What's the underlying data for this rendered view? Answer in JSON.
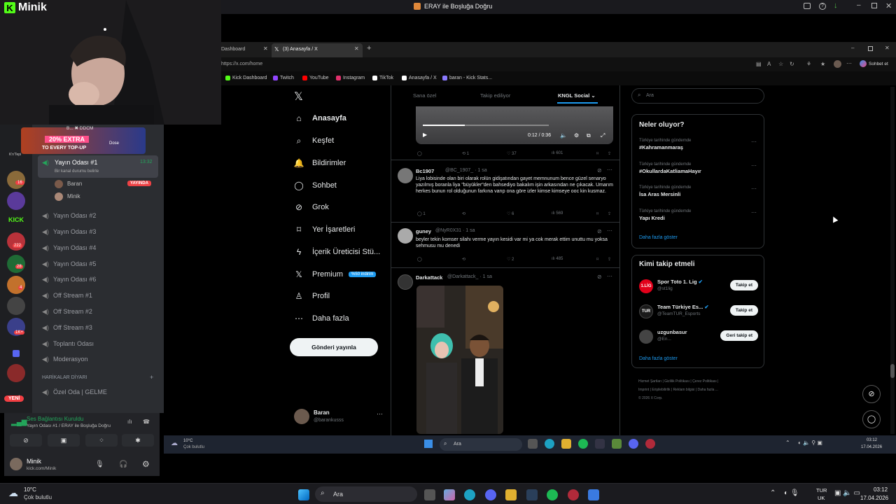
{
  "window_title": "ERAY ile Boşluğa Doğru",
  "stream_logo": "Minik",
  "discord": {
    "promo": {
      "line1": "20% EXTRA",
      "line2": "TO EVERY TOP-UP",
      "brand": "Dose"
    },
    "top_user": "B... ✖ DDCM",
    "active_channel": {
      "name": "Yayın Odası #1",
      "time": "13:32",
      "status": "Bir kanal durumu belirle"
    },
    "members": [
      {
        "name": "Baran",
        "badge": "YAYINDA"
      },
      {
        "name": "Minik",
        "badge": ""
      }
    ],
    "channels": [
      "Yayın Odası #2",
      "Yayın Odası #3",
      "Yayın Odası #4",
      "Yayın Odası #5",
      "Yayın Odası #6",
      "Off Stream #1",
      "Off Stream #2",
      "Off Stream #3",
      "Toplantı Odası",
      "Moderasyon"
    ],
    "category": "HARİKALAR DİYARI",
    "category_channel": "Özel Oda | GELME",
    "server_badges": [
      "16",
      "222",
      "28",
      "4",
      "1K+"
    ],
    "server_label": "K'n'Tepi",
    "new_label": "YENİ",
    "voice": {
      "status": "Ses Bağlantısı Kuruldu",
      "detail": "Yayın Odası #1 / ERAY ile Boşluğa Doğru"
    },
    "user": {
      "name": "Minik",
      "sub": "kick.com/Minik"
    }
  },
  "browser": {
    "tabs": [
      {
        "label": "Dashboard"
      },
      {
        "label": "(3) Anasayfa / X"
      }
    ],
    "url": "https://x.com/home",
    "chat_button": "Sohbet et",
    "bookmarks": [
      "Kick Dashboard",
      "Twitch",
      "YouTube",
      "Instagram",
      "TikTok",
      "Anasayfa / X",
      "baran - Kick Stats..."
    ]
  },
  "x": {
    "nav": [
      {
        "label": "Anasayfa",
        "icon": "home-icon"
      },
      {
        "label": "Keşfet",
        "icon": "search-icon"
      },
      {
        "label": "Bildirimler",
        "icon": "bell-icon"
      },
      {
        "label": "Sohbet",
        "icon": "chat-icon"
      },
      {
        "label": "Grok",
        "icon": "grok-icon"
      },
      {
        "label": "Yer İşaretleri",
        "icon": "bookmark-icon"
      },
      {
        "label": "İçerik Üreticisi Stü...",
        "icon": "lightning-icon"
      },
      {
        "label": "Premium",
        "icon": "x-logo-icon"
      },
      {
        "label": "Profil",
        "icon": "person-icon"
      },
      {
        "label": "Daha fazla",
        "icon": "more-icon"
      }
    ],
    "premium_badge": "%50 indirim",
    "post_button": "Gönderi yayınla",
    "profile": {
      "name": "Baran",
      "handle": "@barankusss"
    },
    "feed_tabs": [
      "Sana özel",
      "Takip ediliyor",
      "KNGL Social"
    ],
    "video": {
      "time": "0:12 / 0:36",
      "stats": {
        "reply": "",
        "retweet": "1",
        "like": "37",
        "views": "601"
      }
    },
    "tweets": [
      {
        "name": "Bc1907",
        "handle": "@BC_1907_ · 1 sa",
        "text": "Liya lobisinde olan biri olarak rolün gidişatından gayet memnunum bence güzel senaryo yazılmış boranla liya \"büyükler\"den bahsediyo bakalım işin arkasından ne çıkacak. Umarım herkes bunun rol olduğunun farkına varıp ona göre izler kimse kimseye ooc kin kusmaz.",
        "reply": "1",
        "retweet": "",
        "like": "6",
        "views": "569"
      },
      {
        "name": "guney",
        "handle": "@NyR0X31 · 1 sa",
        "text": "beyler tekin komser silahı verme yayın kesidi var mi ya cok merak ettim unuttu mu yoksa sehmusu mu denedi",
        "reply": "",
        "retweet": "",
        "like": "2",
        "views": "485"
      },
      {
        "name": "Darkattack",
        "handle": "@Darkattack_ · 1 sa",
        "text": "",
        "reply": "",
        "retweet": "",
        "like": "",
        "views": ""
      }
    ],
    "search_placeholder": "Ara",
    "trends_title": "Neler oluyor?",
    "trends": [
      {
        "context": "Türkiye tarihinde gündemde",
        "name": "#Kahramanmaraş"
      },
      {
        "context": "Türkiye tarihinde gündemde",
        "name": "#OkullardaKatliamaHayır"
      },
      {
        "context": "Türkiye tarihinde gündemde",
        "name": "İsa Aras Mersinli"
      },
      {
        "context": "Türkiye tarihinde gündemde",
        "name": "Yapı Kredi"
      }
    ],
    "show_more": "Daha fazla göster",
    "who_title": "Kimi takip etmeli",
    "who": [
      {
        "name": "Spor Toto 1. Lig",
        "handle": "@st1lig",
        "button": "Takip et"
      },
      {
        "name": "Team Türkiye Es...",
        "handle": "@TeamTUR_Esports",
        "button": "Takip et"
      },
      {
        "name": "uzgunbasur",
        "handle": "@En...",
        "button": "Geri takip et"
      }
    ],
    "footer": [
      "Hizmet Şartları",
      "Gizlilik Politikası",
      "Çerez Politikası",
      "Imprint",
      "Erişilebilirlik",
      "Reklam bilgisi",
      "Daha fazla ...",
      "© 2026 X Corp."
    ]
  },
  "inner_taskbar": {
    "weather_temp": "10°C",
    "weather_desc": "Çok bulutlu",
    "search": "Ara",
    "time": "03:12",
    "date": "17.04.2026"
  },
  "taskbar": {
    "weather_temp": "10°C",
    "weather_desc": "Çok bulutlu",
    "search": "Ara",
    "lang1": "TUR",
    "lang2": "UK",
    "time": "03:12",
    "date": "17.04.2026"
  }
}
